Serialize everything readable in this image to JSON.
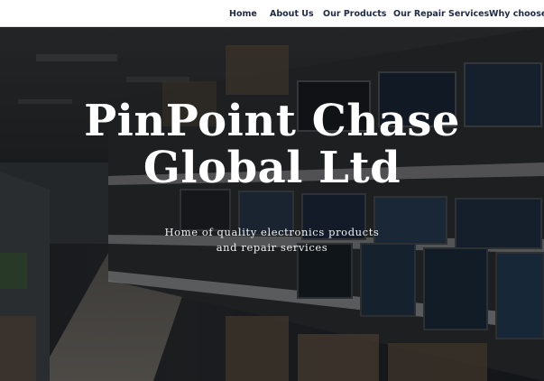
{
  "nav": {
    "items": [
      {
        "label": "Home"
      },
      {
        "label": "About Us"
      },
      {
        "label": "Our Products"
      },
      {
        "label": "Our Repair Services"
      },
      {
        "label": "Why choose u"
      }
    ]
  },
  "hero": {
    "title_line1": "PinPoint Chase",
    "title_line2": "Global Ltd",
    "subtitle_line1": "Home of quality electronics products",
    "subtitle_line2": "and repair services",
    "background": "electronics store aisle with shelves of monitors"
  },
  "colors": {
    "nav_text": "#1f2a44",
    "nav_bg": "#ffffff",
    "hero_text": "#ffffff"
  }
}
